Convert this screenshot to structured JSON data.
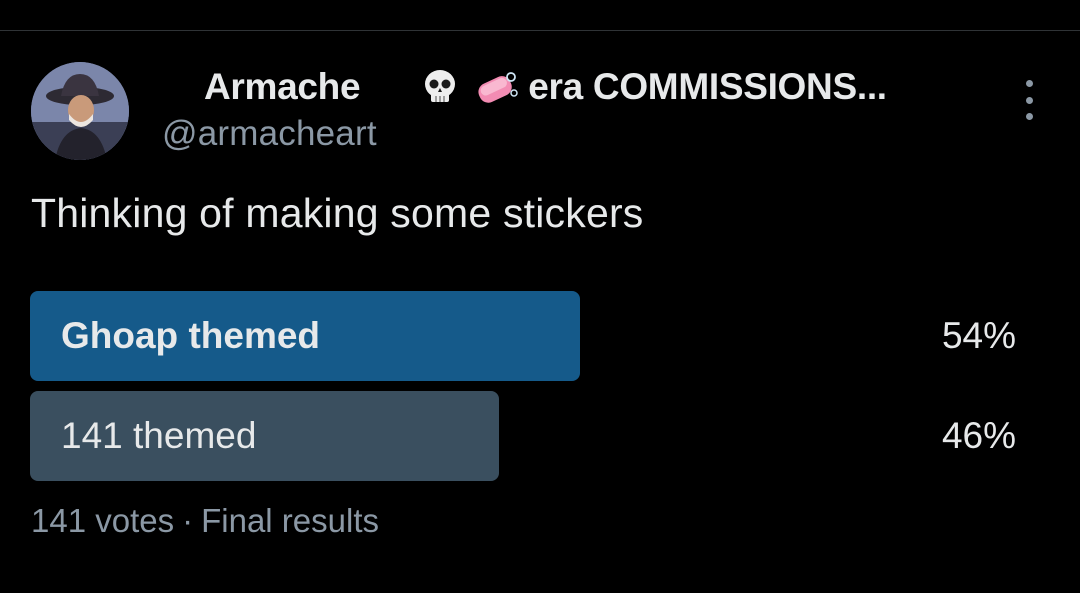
{
  "author": {
    "display_name": "Armache",
    "name_suffix": "era COMMISSIONS...",
    "handle": "@armacheart"
  },
  "tweet": {
    "text": "Thinking of making some stickers"
  },
  "poll": {
    "options": [
      {
        "label": "Ghoap themed",
        "percent_text": "54%",
        "percent": 54,
        "winner": true
      },
      {
        "label": "141 themed",
        "percent_text": "46%",
        "percent": 46,
        "winner": false
      }
    ],
    "votes": "141 votes",
    "separator": "·",
    "status": "Final results"
  },
  "colors": {
    "background": "#000000",
    "text": "#e7e9ea",
    "muted": "#8b98a5",
    "winner_bar": "#155a8a",
    "loser_bar": "#3a4f5f"
  },
  "icons": {
    "moon": "crescent-moon-icon",
    "skull": "skull-icon",
    "soap": "soap-icon",
    "more": "more-options-icon"
  }
}
